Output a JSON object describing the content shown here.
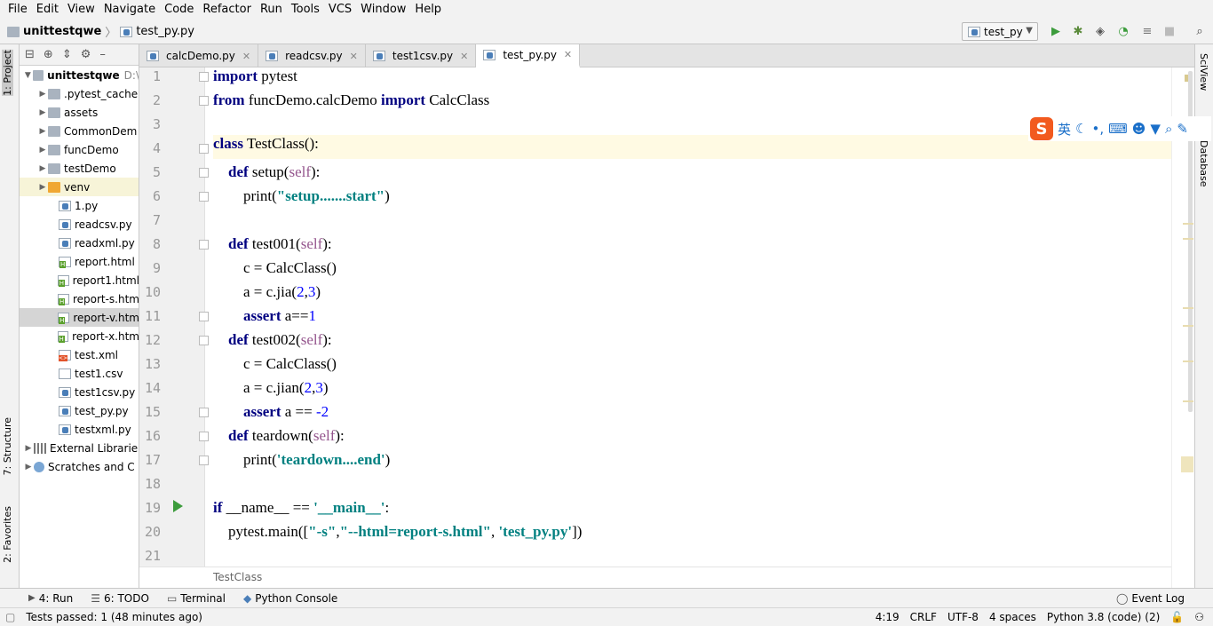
{
  "menu": [
    "File",
    "Edit",
    "View",
    "Navigate",
    "Code",
    "Refactor",
    "Run",
    "Tools",
    "VCS",
    "Window",
    "Help"
  ],
  "breadcrumb": {
    "project": "unittestqwe",
    "file": "test_py.py"
  },
  "run_config": "test_py",
  "left_tabs": {
    "project": "1: Project",
    "structure": "7: Structure",
    "favorites": "2: Favorites"
  },
  "right_tabs": {
    "sciview": "SciView",
    "database": "Database"
  },
  "project_tree": [
    {
      "label": "unittestqwe",
      "suffix": "D:\\",
      "type": "root"
    },
    {
      "label": ".pytest_cache",
      "type": "folder"
    },
    {
      "label": "assets",
      "type": "folder"
    },
    {
      "label": "CommonDem",
      "type": "folder"
    },
    {
      "label": "funcDemo",
      "type": "folder"
    },
    {
      "label": "testDemo",
      "type": "folder"
    },
    {
      "label": "venv",
      "type": "venv"
    },
    {
      "label": "1.py",
      "type": "py"
    },
    {
      "label": "readcsv.py",
      "type": "py"
    },
    {
      "label": "readxml.py",
      "type": "py"
    },
    {
      "label": "report.html",
      "type": "html"
    },
    {
      "label": "report1.html",
      "type": "html"
    },
    {
      "label": "report-s.htm",
      "type": "html"
    },
    {
      "label": "report-v.htm",
      "type": "html"
    },
    {
      "label": "report-x.htm",
      "type": "html"
    },
    {
      "label": "test.xml",
      "type": "xml"
    },
    {
      "label": "test1.csv",
      "type": "csv"
    },
    {
      "label": "test1csv.py",
      "type": "py"
    },
    {
      "label": "test_py.py",
      "type": "py"
    },
    {
      "label": "testxml.py",
      "type": "py"
    },
    {
      "label": "External Librarie",
      "type": "lib"
    },
    {
      "label": "Scratches and C",
      "type": "scratch"
    }
  ],
  "editor_tabs": [
    "calcDemo.py",
    "readcsv.py",
    "test1csv.py",
    "test_py.py"
  ],
  "code": {
    "l1_kw": "import",
    "l1_rest": " pytest",
    "l2_kw1": "from",
    "l2_mid": " funcDemo.calcDemo ",
    "l2_kw2": "import",
    "l2_rest": " CalcClass",
    "l4_kw": "class",
    "l4_rest": " TestClass():",
    "l5_kw": "def",
    "l5_a": " setup(",
    "l5_self": "self",
    "l5_b": "):",
    "l6_a": "print(",
    "l6_str": "\"setup.......start\"",
    "l6_b": ")",
    "l8_kw": "def",
    "l8_a": " test001(",
    "l8_self": "self",
    "l8_b": "):",
    "l9": "c = CalcClass()",
    "l10_a": "a = c.jia(",
    "l10_n1": "2",
    "l10_c": ",",
    "l10_n2": "3",
    "l10_b": ")",
    "l11_kw": "assert",
    "l11_a": " a==",
    "l11_n": "1",
    "l12_kw": "def",
    "l12_a": " test002(",
    "l12_self": "self",
    "l12_b": "):",
    "l13": "c = CalcClass()",
    "l14_a": "a = c.jian(",
    "l14_n1": "2",
    "l14_c": ",",
    "l14_n2": "3",
    "l14_b": ")",
    "l15_kw": "assert",
    "l15_a": " a == ",
    "l15_n": "-2",
    "l16_kw": "def",
    "l16_a": " teardown(",
    "l16_self": "self",
    "l16_b": "):",
    "l17_a": "print(",
    "l17_str": "'teardown....end'",
    "l17_b": ")",
    "l19_kw": "if",
    "l19_a": " __name__ == ",
    "l19_str": "'__main__'",
    "l19_b": ":",
    "l20_a": "pytest.main([",
    "l20_s1": "\"-s\"",
    "l20_c1": ",",
    "l20_s2": "\"--html=report-s.html\"",
    "l20_c2": ", ",
    "l20_s3": "'test_py.py'",
    "l20_b": "])"
  },
  "line_numbers": [
    "1",
    "2",
    "3",
    "4",
    "5",
    "6",
    "7",
    "8",
    "9",
    "10",
    "11",
    "12",
    "13",
    "14",
    "15",
    "16",
    "17",
    "18",
    "19",
    "20",
    "21"
  ],
  "editor_breadcrumb": "TestClass",
  "ime": {
    "logo": "S",
    "mode": "英"
  },
  "bottom_tabs": {
    "run": "4: Run",
    "todo": "6: TODO",
    "terminal": "Terminal",
    "console": "Python Console",
    "eventlog": "Event Log"
  },
  "status": {
    "message": "Tests passed: 1 (48 minutes ago)",
    "position": "4:19",
    "line_sep": "CRLF",
    "encoding": "UTF-8",
    "indent": "4 spaces",
    "interpreter": "Python 3.8 (code) (2)"
  }
}
